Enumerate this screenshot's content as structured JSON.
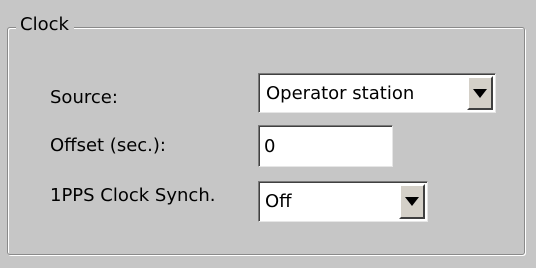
{
  "group": {
    "title": "Clock"
  },
  "source": {
    "label": "Source:",
    "value": "Operator station",
    "dropdown_icon": "chevron-down-icon"
  },
  "offset": {
    "label": "Offset (sec.):",
    "value": "0"
  },
  "pps": {
    "label": "1PPS Clock Synch.",
    "value": "Off",
    "dropdown_icon": "chevron-down-icon"
  }
}
